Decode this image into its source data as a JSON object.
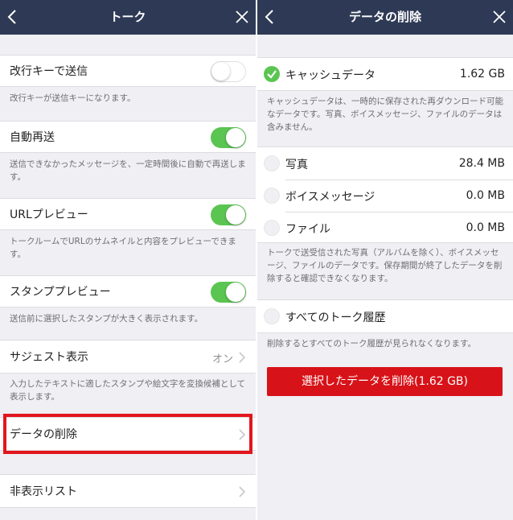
{
  "left": {
    "title": "トーク",
    "settings": {
      "send_with_enter": {
        "label": "改行キーで送信",
        "desc": "改行キーが送信キーになります。",
        "enabled": false
      },
      "auto_resend": {
        "label": "自動再送",
        "desc": "送信できなかったメッセージを、一定時間後に自動で再送します。",
        "enabled": true
      },
      "url_preview": {
        "label": "URLプレビュー",
        "desc": "トークルームでURLのサムネイルと内容をプレビューできます。",
        "enabled": true
      },
      "sticker_preview": {
        "label": "スタンププレビュー",
        "desc": "送信前に選択したスタンプが大きく表示されます。",
        "enabled": true
      },
      "suggest": {
        "label": "サジェスト表示",
        "value": "オン",
        "desc": "入力したテキストに適したスタンプや絵文字を変換候補として表示します。"
      },
      "delete_data": {
        "label": "データの削除"
      },
      "hidden_list": {
        "label": "非表示リスト"
      }
    }
  },
  "right": {
    "title": "データの削除",
    "cache": {
      "label": "キャッシュデータ",
      "size": "1.62 GB",
      "checked": true,
      "desc": "キャッシュデータは、一時的に保存された再ダウンロード可能なデータです。写真、ボイスメッセージ、ファイルのデータは含みません。"
    },
    "photos": {
      "label": "写真",
      "size": "28.4 MB",
      "checked": false
    },
    "voice": {
      "label": "ボイスメッセージ",
      "size": "0.0 MB",
      "checked": false
    },
    "files": {
      "label": "ファイル",
      "size": "0.0 MB",
      "checked": false
    },
    "media_desc": "トークで送受信された写真（アルバムを除く）、ボイスメッセージ、ファイルのデータです。保存期間が終了したデータを削除すると確認できなくなります。",
    "history": {
      "label": "すべてのトーク履歴",
      "checked": false,
      "desc": "削除するとすべてのトーク履歴が見られなくなります。"
    },
    "delete_button": "選択したデータを削除(1.62 GB)"
  },
  "colors": {
    "navbar": "#2e3a55",
    "toggle_on": "#5bc552",
    "delete_button": "#d71218",
    "highlight": "#e3161d",
    "background": "#efeff4"
  },
  "icons": [
    "back-chevron-icon",
    "close-icon",
    "chevron-right-icon",
    "check-icon"
  ]
}
